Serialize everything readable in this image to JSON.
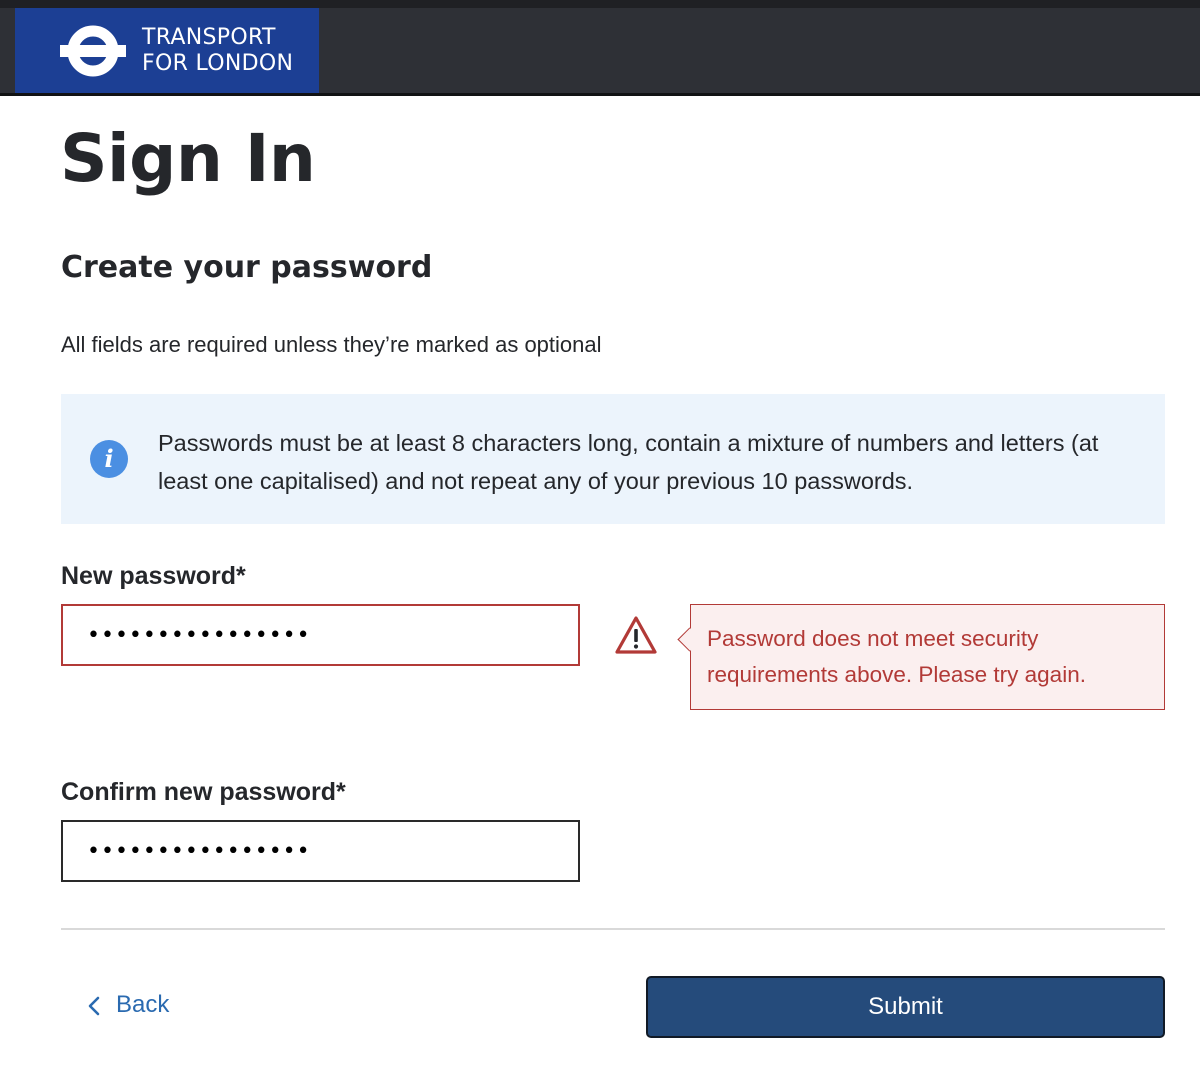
{
  "header": {
    "logo_line1": "TRANSPORT",
    "logo_line2": "FOR LONDON",
    "brand_color": "#1c3f94",
    "roundel_color": "#ffffff"
  },
  "page": {
    "title": "Sign In",
    "subtitle": "Create your password",
    "required_note": "All fields are required unless they’re marked as optional"
  },
  "info_box": {
    "icon": "info-icon",
    "icon_glyph": "i",
    "text": "Passwords must be at least 8 characters long, contain a mixture of numbers and letters (at least one capitalised) and not repeat any of your previous 10 passwords."
  },
  "form": {
    "new_password": {
      "label": "New password*",
      "value": "••••••••••••••••",
      "state": "error",
      "error_icon": "warning-icon",
      "error_message": "Password does not meet security requirements above. Please try again."
    },
    "confirm_password": {
      "label": "Confirm new password*",
      "value": "••••••••••••••••"
    }
  },
  "actions": {
    "back_label": "Back",
    "back_icon": "chevron-left-icon",
    "submit_label": "Submit"
  },
  "colors": {
    "error": "#b23a37",
    "error_bg": "#fbefef",
    "info_bg": "#ecf4fc",
    "info_icon": "#4b8fe2",
    "link": "#2a6ab0",
    "primary_button": "#254b7b",
    "header_bg": "#2e3036"
  }
}
